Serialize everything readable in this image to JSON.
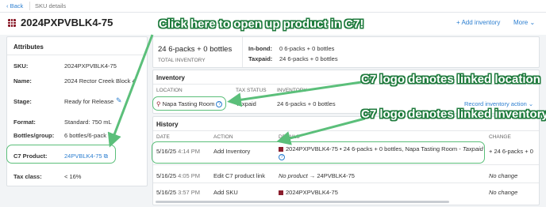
{
  "topbar": {
    "back": "Back",
    "crumb": "SKU details"
  },
  "header": {
    "title": "2024PXPVBLK4-75",
    "add_inventory": "Add inventory",
    "more": "More"
  },
  "attributes": {
    "heading": "Attributes",
    "rows": [
      {
        "label": "SKU:",
        "value": "2024PXPVBLK4-75"
      },
      {
        "label": "Name:",
        "value": "2024 Rector Creek Block 4"
      },
      {
        "label": "Stage:",
        "value": "Ready for Release"
      },
      {
        "label": "Format:",
        "value": "Standard: 750 mL"
      },
      {
        "label": "Bottles/group:",
        "value": "6 bottles/6-pack"
      },
      {
        "label": "C7 Product:",
        "value": "24PVBLK4-75"
      },
      {
        "label": "Tax class:",
        "value": "< 16%"
      }
    ]
  },
  "summary": {
    "total": "24 6-packs + 0 bottles",
    "total_label": "TOTAL INVENTORY",
    "inbond_label": "In-bond:",
    "inbond_value": "0 6-packs + 0 bottles",
    "taxpaid_label": "Taxpaid:",
    "taxpaid_value": "24 6-packs + 0 bottles"
  },
  "inventory": {
    "heading": "Inventory",
    "columns": [
      "LOCATION",
      "TAX STATUS",
      "INVENTORY"
    ],
    "row": {
      "location": "Napa Tasting Room",
      "tax_status": "Taxpaid",
      "inventory": "24 6-packs + 0 bottles",
      "action": "Record inventory action"
    }
  },
  "history": {
    "heading": "History",
    "columns": [
      "DATE",
      "ACTION",
      "DETAILS",
      "CHANGE"
    ],
    "rows": [
      {
        "date": "5/16/25",
        "time": "4:14 PM",
        "action": "Add Inventory",
        "details_sku": "2024PXPVBLK4-75",
        "details_rest": "• 24 6-packs + 0 bottles, Napa Tasting Room -",
        "details_status": "Taxpaid",
        "change": "+ 24 6-packs + 0"
      },
      {
        "date": "5/16/25",
        "time": "4:05 PM",
        "action": "Edit C7 product link",
        "details_from": "No product",
        "details_to": "24PVBLK4-75",
        "change": "No change"
      },
      {
        "date": "5/16/25",
        "time": "3:57 PM",
        "action": "Add SKU",
        "details_sku": "2024PXPVBLK4-75",
        "change": "No change"
      }
    ]
  },
  "callouts": {
    "open_product": "Click here to open up product in C7!",
    "linked_location": "C7 logo denotes linked location",
    "linked_inventory": "C7 logo denotes linked inventory"
  },
  "colors": {
    "accent": "#2d7fd0",
    "brand": "#8b1e2d",
    "callout_green": "#5bbf7a"
  }
}
